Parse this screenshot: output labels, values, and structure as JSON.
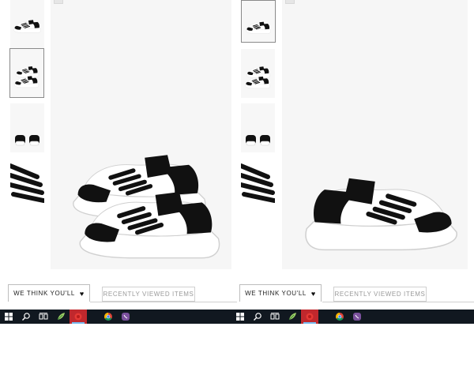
{
  "panels": [
    {
      "name": "left",
      "thumbnails": [
        {
          "icon": "sneaker-side-thumb-icon",
          "selected": false
        },
        {
          "icon": "sneaker-pair-thumb-icon",
          "selected": true
        },
        {
          "icon": "sneaker-back-thumb-icon",
          "selected": false
        },
        {
          "icon": "sneaker-laces-closeup-thumb-icon",
          "selected": false
        }
      ],
      "main_image_icon": "sneaker-pair-product-image",
      "tabs": {
        "active": "WE THINK YOU'LL",
        "active_icon": "heart-icon",
        "inactive": "RECENTLY VIEWED ITEMS"
      }
    },
    {
      "name": "right",
      "thumbnails": [
        {
          "icon": "sneaker-side-thumb-icon",
          "selected": true
        },
        {
          "icon": "sneaker-pair-thumb-icon",
          "selected": false
        },
        {
          "icon": "sneaker-back-thumb-icon",
          "selected": false
        },
        {
          "icon": "sneaker-laces-closeup-thumb-icon",
          "selected": false
        }
      ],
      "main_image_icon": "sneaker-single-product-image",
      "tabs": {
        "active": "WE THINK YOU'LL",
        "active_icon": "heart-icon",
        "inactive": "RECENTLY VIEWED ITEMS"
      }
    }
  ],
  "taskbar": {
    "items": [
      {
        "icon": "windows-start-icon"
      },
      {
        "icon": "search-icon"
      },
      {
        "icon": "task-view-icon"
      },
      {
        "icon": "feather-app-icon"
      },
      {
        "icon": "red-app-icon",
        "active": true
      },
      {
        "icon": "chrome-icon"
      },
      {
        "icon": "viber-icon"
      }
    ]
  },
  "colors": {
    "accent_red": "#c0282d",
    "taskbar": "#111820",
    "image_bg": "#f6f6f6",
    "thumb_border": "#8a8a8a"
  }
}
